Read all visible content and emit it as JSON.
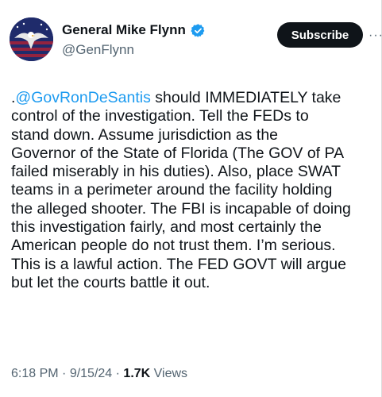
{
  "author": {
    "display_name": "General Mike Flynn",
    "handle": "@GenFlynn",
    "verified": true,
    "verified_color": "#1d9bf0"
  },
  "actions": {
    "subscribe_label": "Subscribe",
    "more_label": "···"
  },
  "tweet": {
    "prefix": ".",
    "mention": "@GovRonDeSantis",
    "body": " should IMMEDIATELY take\ncontrol of the investigation. Tell the FEDs to\nstand down. Assume jurisdiction as the\nGovernor of the State of Florida (The GOV of PA\nfailed miserably in his duties). Also, place SWAT\nteams in a perimeter around the facility holding\nthe alleged shooter. The FBI is incapable of doing\nthis investigation fairly, and most certainly the\nAmerican people do not trust them. I’m serious.\nThis is a lawful action. The FED GOVT will argue\nbut let the courts battle it out."
  },
  "meta": {
    "time": "6:18 PM",
    "separator": " · ",
    "date": "9/15/24",
    "views_count": "1.7K",
    "views_label": " Views"
  },
  "colors": {
    "text": "#0f1419",
    "secondary": "#536471",
    "link": "#1d9bf0",
    "button_bg": "#0f1419"
  }
}
